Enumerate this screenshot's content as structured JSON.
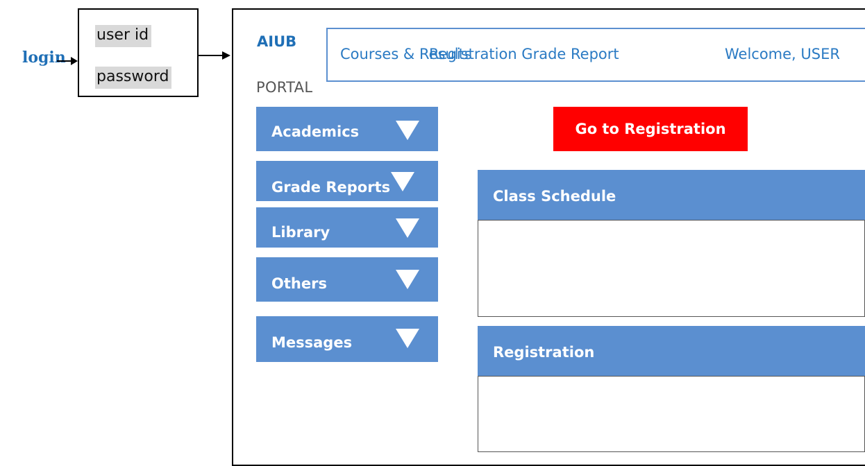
{
  "login": {
    "label": "login",
    "user_id": "user id",
    "password": "password"
  },
  "brand": {
    "name": "AIUB",
    "sub": "PORTAL"
  },
  "nav": {
    "courses_results": "Courses & Results",
    "registration_grade_report": "Registration Grade Report",
    "welcome": "Welcome, USER"
  },
  "menu": [
    {
      "label": "Academics"
    },
    {
      "label": "Grade Reports"
    },
    {
      "label": "Library"
    },
    {
      "label": "Others"
    },
    {
      "label": "Messages"
    }
  ],
  "go_registration": "Go to Registration",
  "panels": {
    "class_schedule": "Class Schedule",
    "registration": "Registration"
  },
  "colors": {
    "accent_blue": "#5b8fd0",
    "link_blue": "#2a7ac3",
    "cta_red": "#ff0000"
  }
}
